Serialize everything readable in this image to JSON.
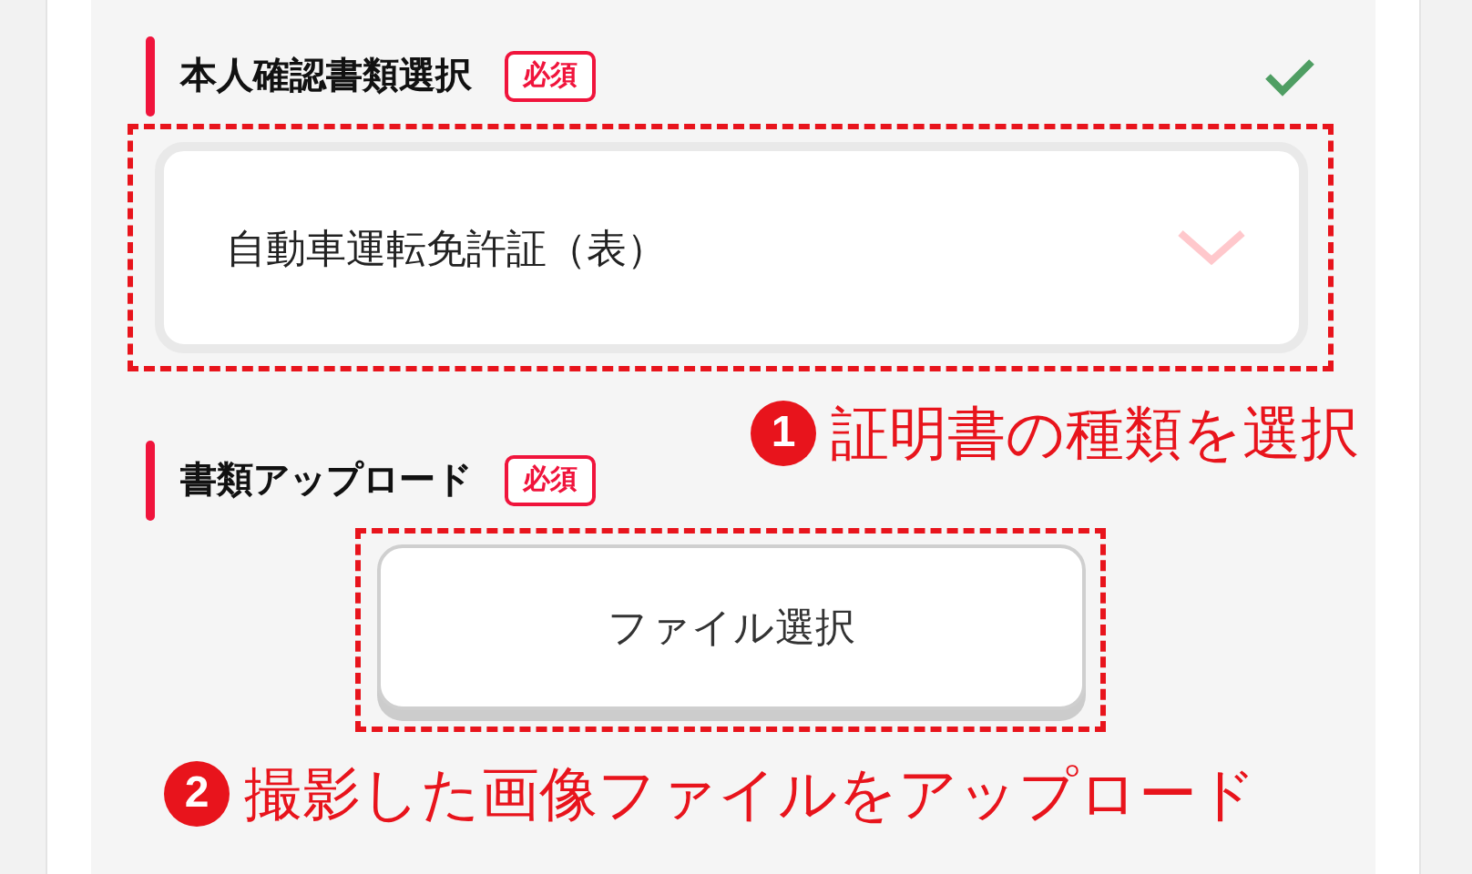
{
  "sections": [
    {
      "kind": "select",
      "title": "本人確認書類選択",
      "badge": "必須",
      "complete": true,
      "value": "自動車運転免許証（表）"
    },
    {
      "kind": "file",
      "title": "書類アップロード",
      "badge": "必須",
      "complete": false,
      "button": "ファイル選択"
    }
  ],
  "annotations": [
    {
      "number": "1",
      "text": "証明書の種類を選択"
    },
    {
      "number": "2",
      "text": "撮影した画像ファイルをアップロード"
    }
  ]
}
